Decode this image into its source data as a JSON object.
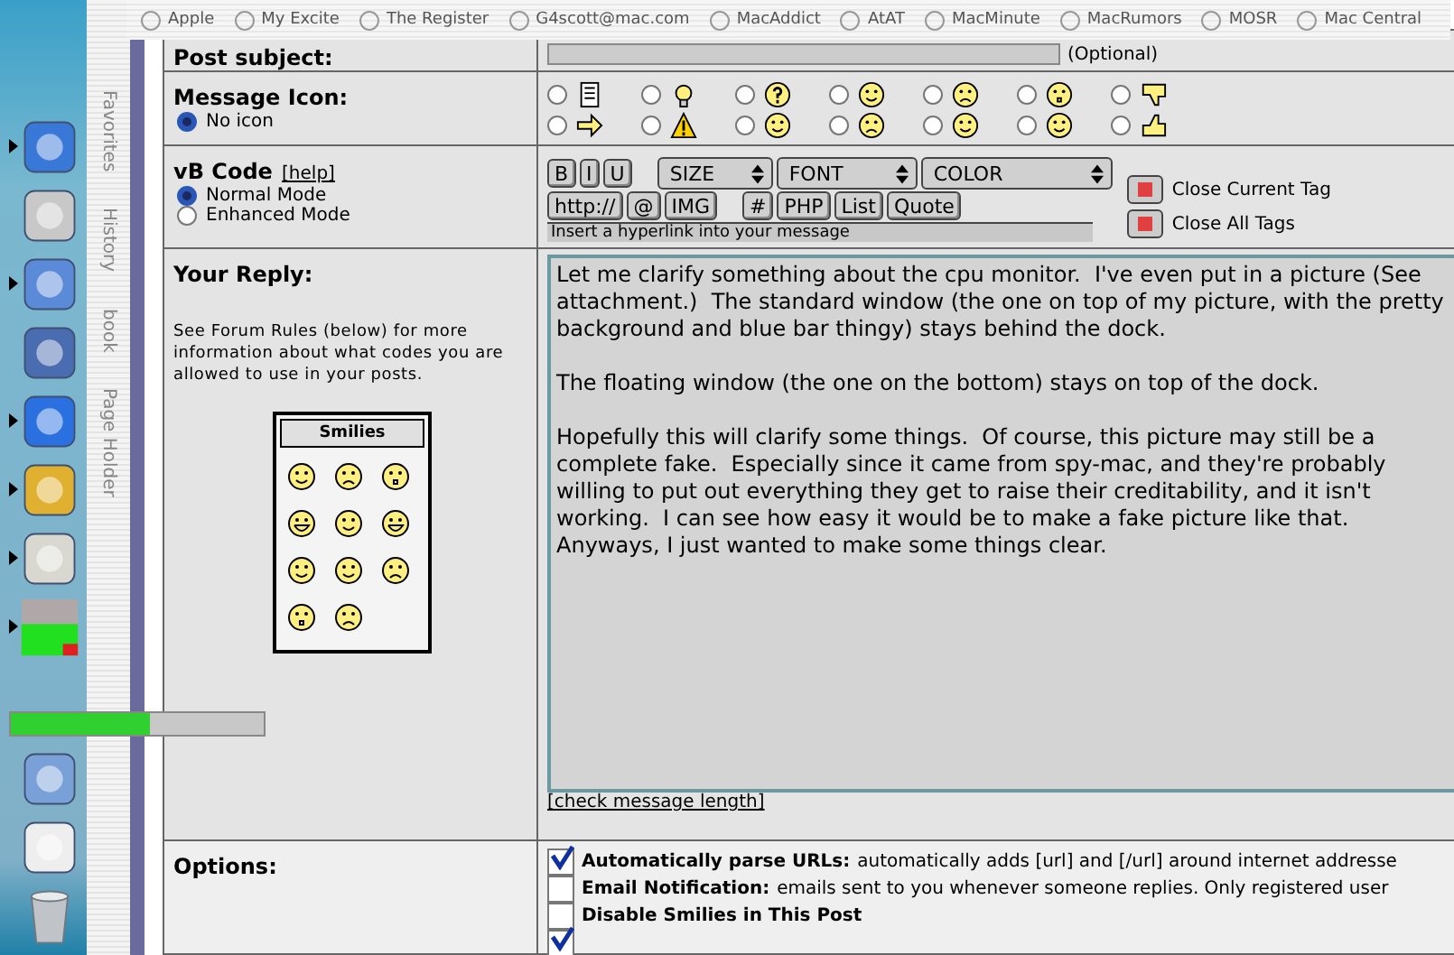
{
  "favorites_bar": [
    "Apple",
    "My Excite",
    "The Register",
    "G4scott@mac.com",
    "MacAddict",
    "AtAT",
    "MacMinute",
    "MacRumors",
    "MOSR",
    "Mac Central"
  ],
  "dock": [
    {
      "kind": "finder",
      "running": true
    },
    {
      "kind": "apple",
      "running": false
    },
    {
      "kind": "music",
      "running": true
    },
    {
      "kind": "photo",
      "running": false
    },
    {
      "kind": "browser",
      "running": true
    },
    {
      "kind": "chat",
      "running": true
    },
    {
      "kind": "editor",
      "running": true
    },
    {
      "kind": "monitor",
      "running": true
    },
    {
      "kind": "folder",
      "running": false
    },
    {
      "kind": "mail",
      "running": false
    },
    {
      "kind": "trash",
      "running": false
    }
  ],
  "cpu_meter": {
    "level": 0.55
  },
  "side_tabs": [
    "Favorites",
    "History",
    "book",
    "Page Holder"
  ],
  "post_subject": {
    "label": "Post subject:",
    "hint": "(Optional)"
  },
  "message_icon": {
    "label": "Message Icon:",
    "none_label": "No icon",
    "none_selected": true,
    "icons": [
      {
        "kind": "note",
        "selected": false
      },
      {
        "kind": "arrow",
        "selected": false
      },
      {
        "kind": "bulb",
        "selected": false
      },
      {
        "kind": "warning",
        "selected": false
      },
      {
        "kind": "question",
        "selected": false
      },
      {
        "kind": "cool",
        "selected": false
      },
      {
        "kind": "smile",
        "selected": false
      },
      {
        "kind": "angry",
        "selected": false
      },
      {
        "kind": "sad",
        "selected": false
      },
      {
        "kind": "grin",
        "selected": false
      },
      {
        "kind": "shock",
        "selected": false
      },
      {
        "kind": "smile",
        "selected": false
      },
      {
        "kind": "thumbdown",
        "selected": false
      },
      {
        "kind": "thumbup",
        "selected": false
      }
    ]
  },
  "vb_code": {
    "label": "vB Code",
    "help": "[help]",
    "modes": [
      {
        "label": "Normal Mode",
        "selected": true
      },
      {
        "label": "Enhanced Mode",
        "selected": false
      }
    ],
    "row1": [
      "B",
      "I",
      "U"
    ],
    "selects": [
      "SIZE",
      "FONT",
      "COLOR"
    ],
    "row2": [
      "http://",
      "@",
      "IMG",
      "#",
      "PHP",
      "List",
      "Quote"
    ],
    "status": "Insert a hyperlink into your message",
    "close": [
      "Close Current Tag",
      "Close All Tags"
    ]
  },
  "reply": {
    "label": "Your Reply:",
    "note": "See Forum Rules (below) for more information about what codes you are allowed to use in your posts.",
    "smilies_title": "Smilies",
    "smilies": [
      {
        "kind": "smile"
      },
      {
        "kind": "frown"
      },
      {
        "kind": "shock"
      },
      {
        "kind": "grin"
      },
      {
        "kind": "wink"
      },
      {
        "kind": "laugh"
      },
      {
        "kind": "cool"
      },
      {
        "kind": "eek"
      },
      {
        "kind": "mad"
      },
      {
        "kind": "oh"
      },
      {
        "kind": "confused"
      }
    ],
    "text": "Let me clarify something about the cpu monitor.  I've even put in a picture (See attachment.)  The standard window (the one on top of my picture, with the pretty background and blue bar thingy) stays behind the dock.\n\nThe floating window (the one on the bottom) stays on top of the dock.\n\nHopefully this will clarify some things.  Of course, this picture may still be a complete fake.  Especially since it came from spy-mac, and they're probably willing to put out everything they get to raise their creditability, and it isn't working.  I can see how easy it would be to make a fake picture like that.  Anyways, I just wanted to make some things clear.",
    "check_link": "[check message length]"
  },
  "options": {
    "label": "Options:",
    "items": [
      {
        "checked": true,
        "title": "Automatically parse URLs:",
        "text": "automatically adds [url] and [/url] around internet addresse"
      },
      {
        "checked": false,
        "title": "Email Notification:",
        "text": "emails sent to you whenever someone replies. Only registered user"
      },
      {
        "checked": false,
        "title": "Disable Smilies in This Post"
      },
      {
        "checked": true
      }
    ]
  }
}
